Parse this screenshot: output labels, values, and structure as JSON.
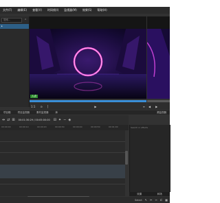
{
  "menubar": {
    "items": [
      "文件(F)",
      "编辑(E)",
      "查看(V)",
      "时间线(I)",
      "监视器(M)",
      "效果(S)",
      "帮助(H)"
    ]
  },
  "left_panel": {
    "search_placeholder": "搜索..."
  },
  "monitor": {
    "overlay_tag": "入点"
  },
  "monitor_controls": {
    "zoom_label": "1:1",
    "menu_icon": "menu-icon"
  },
  "tabs": {
    "items": [
      "项目箱",
      "项目监视器",
      "素材监视器",
      "库",
      "源监视器"
    ]
  },
  "timeline": {
    "timecode": "00:01:30:29 / 00:05:00:00",
    "ruler_labels": [
      "00:00:00",
      "00:00:10",
      "00:00:20",
      "00:00:30",
      "00:00:40",
      "00:00:50",
      "00:01:00"
    ]
  },
  "effects": {
    "search_placeholder": "Search in effects"
  },
  "right_tabs": {
    "items": [
      "效果",
      "转场"
    ]
  },
  "statusbar": {
    "select_label": "Select"
  },
  "colors": {
    "accent": "#3a8fd8",
    "tag_green": "#2f8f2f"
  }
}
